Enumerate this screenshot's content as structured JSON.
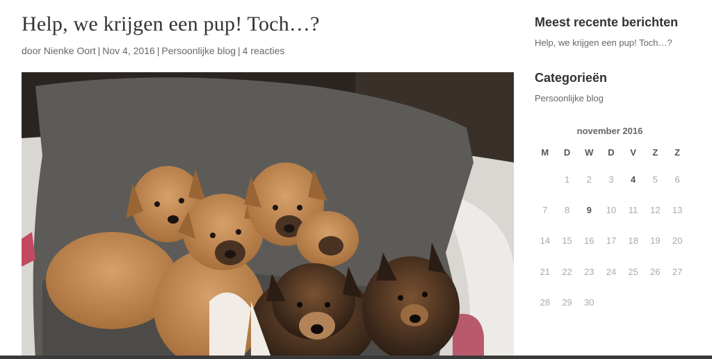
{
  "post": {
    "title": "Help, we krijgen een pup! Toch…?",
    "meta": {
      "prefix": "door",
      "author": "Nienke Oort",
      "date": "Nov 4, 2016",
      "category": "Persoonlijke blog",
      "comments": "4 reacties",
      "separator": "|"
    },
    "image_subject": "puppies-photo"
  },
  "sidebar": {
    "recent_title": "Meest recente berichten",
    "recent_items": [
      "Help, we krijgen een pup! Toch…?"
    ],
    "categories_title": "Categorieën",
    "categories_items": [
      "Persoonlijke blog"
    ],
    "calendar": {
      "caption": "november 2016",
      "weekdays": [
        "M",
        "D",
        "W",
        "D",
        "V",
        "Z",
        "Z"
      ],
      "weeks": [
        [
          "",
          "1",
          "2",
          "3",
          "4",
          "5",
          "6"
        ],
        [
          "7",
          "8",
          "9",
          "10",
          "11",
          "12",
          "13"
        ],
        [
          "14",
          "15",
          "16",
          "17",
          "18",
          "19",
          "20"
        ],
        [
          "21",
          "22",
          "23",
          "24",
          "25",
          "26",
          "27"
        ],
        [
          "28",
          "29",
          "30",
          "",
          "",
          "",
          ""
        ]
      ],
      "linked_days": [
        "4",
        "9"
      ]
    }
  },
  "colors": {
    "title": "#333333",
    "meta": "#666666",
    "calendar_day": "#aaaaaa"
  }
}
